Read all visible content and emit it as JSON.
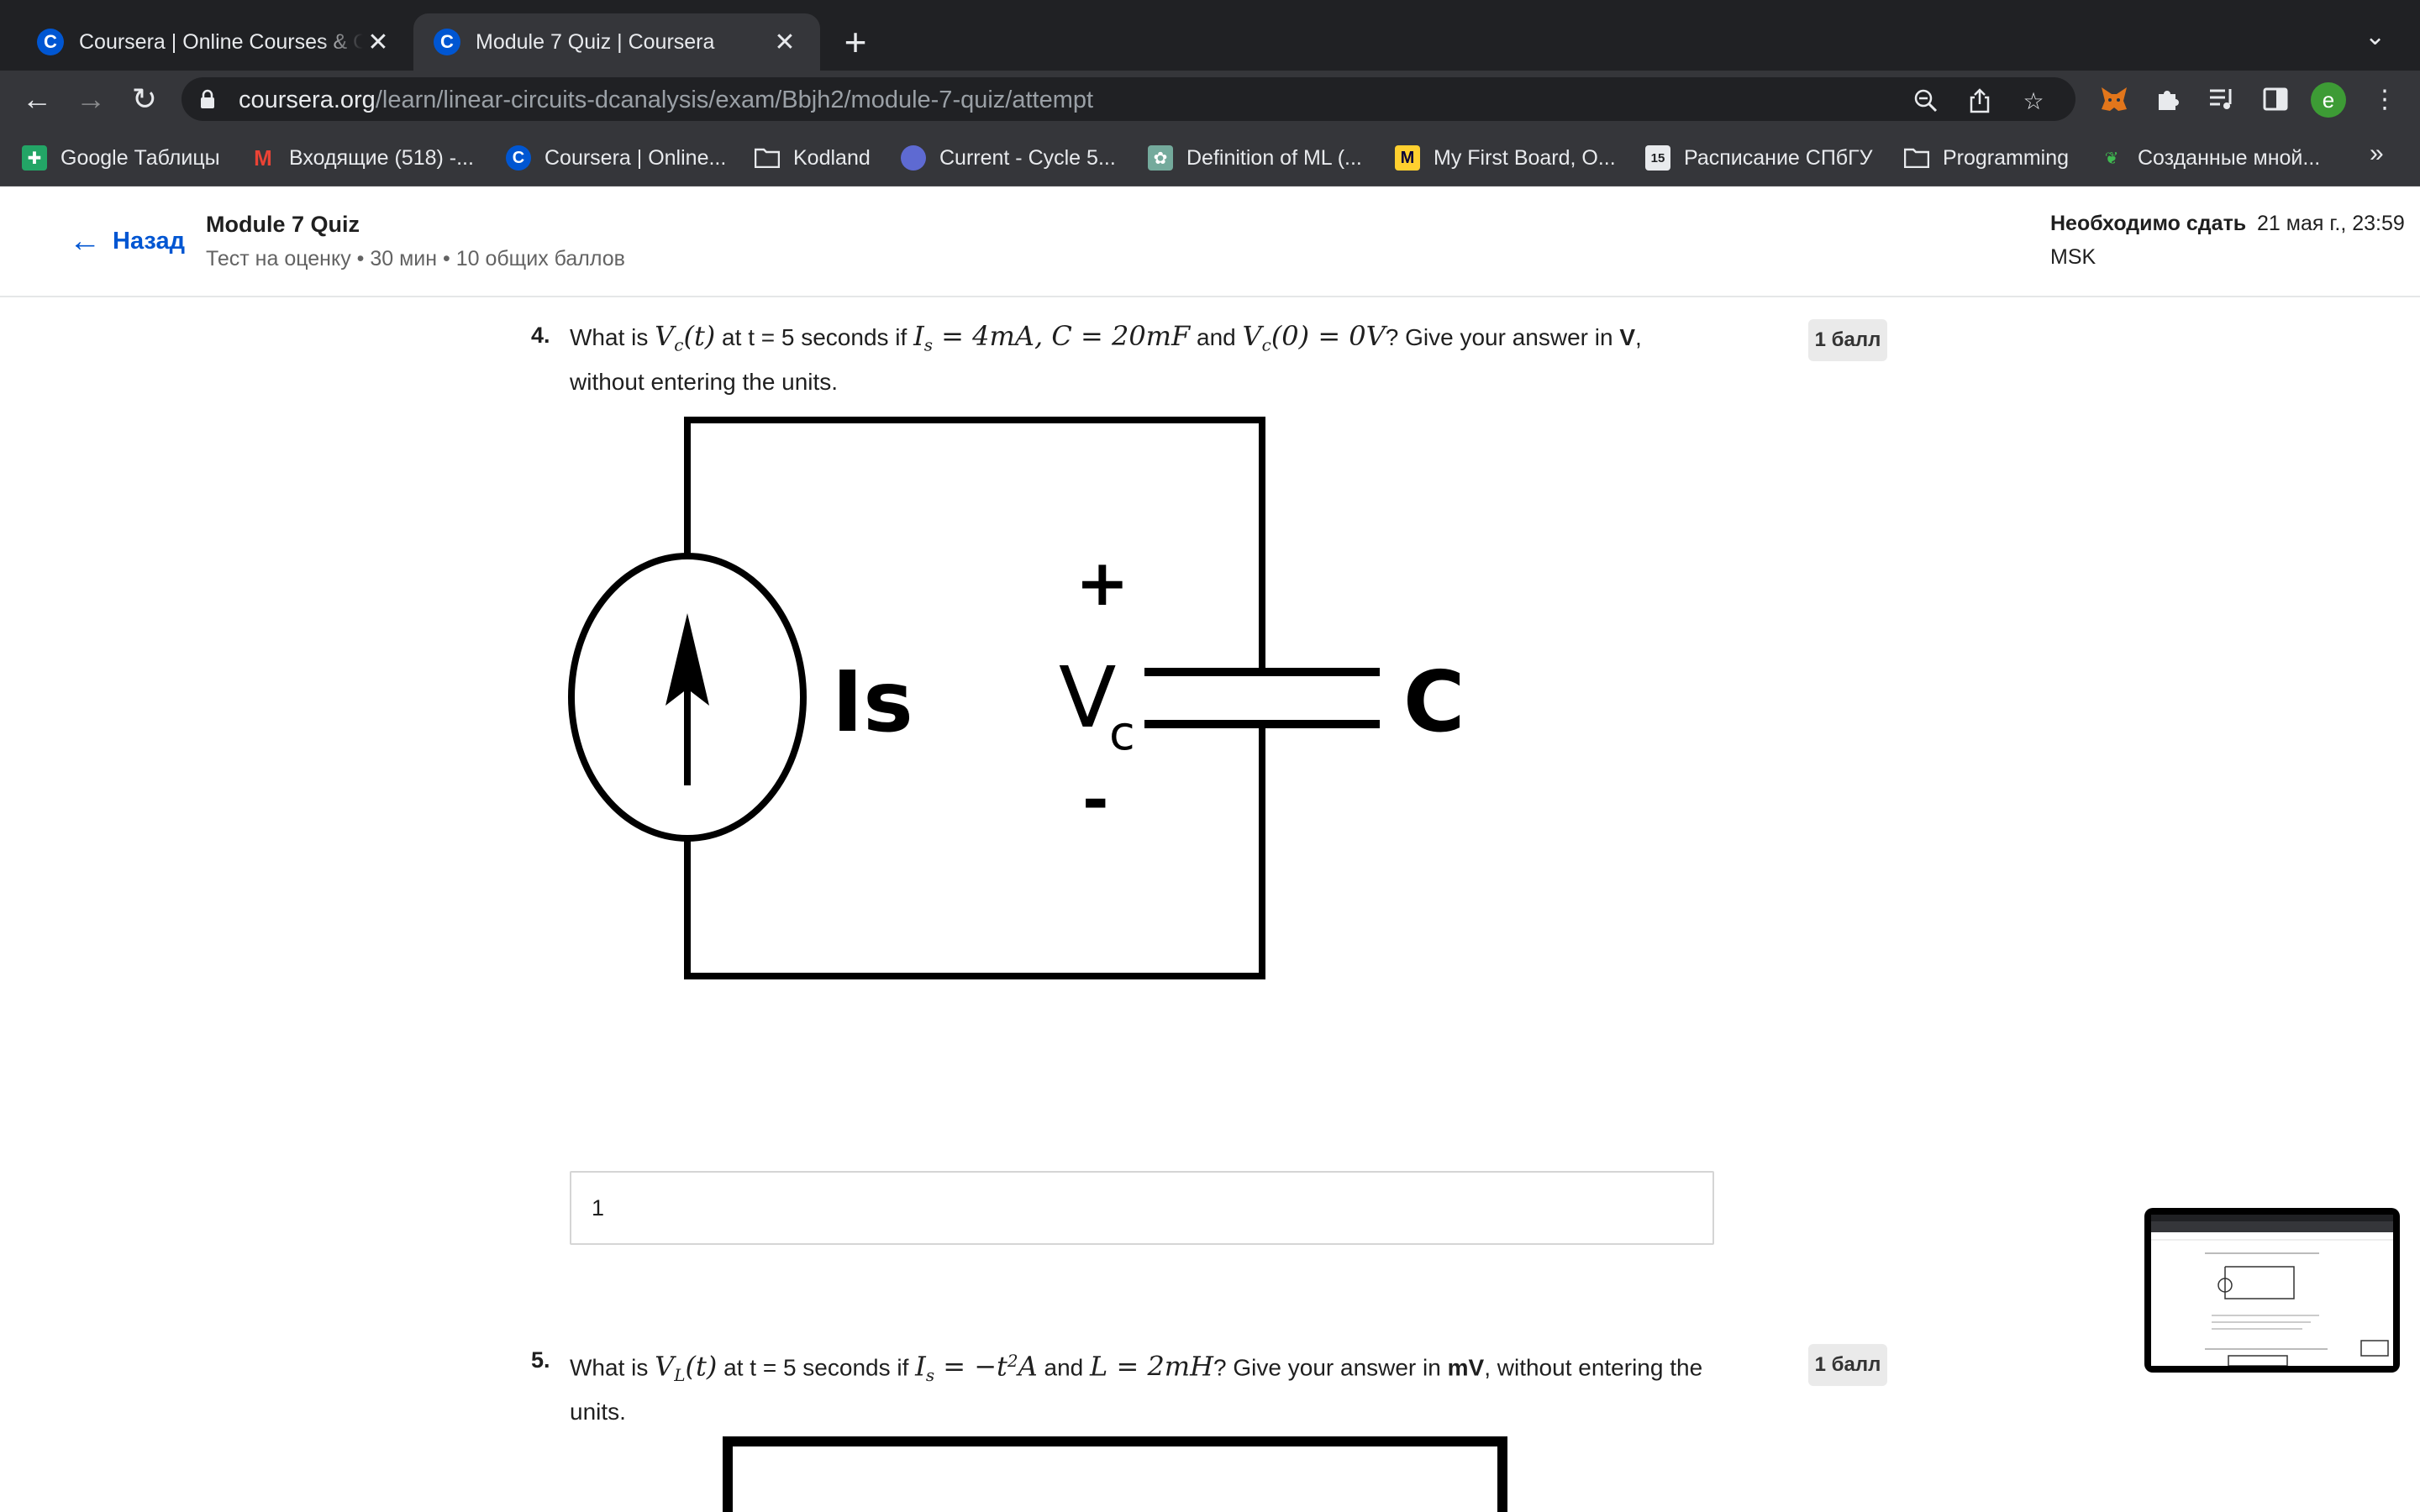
{
  "browser": {
    "tabs": [
      {
        "title": "Coursera | Online Courses & Credentials From Top Educators",
        "favicon": "C",
        "active": false
      },
      {
        "title": "Module 7 Quiz | Coursera",
        "favicon": "C",
        "active": true
      }
    ],
    "url_host": "coursera.org",
    "url_path": "/learn/linear-circuits-dcanalysis/exam/Bbjh2/module-7-quiz/attempt",
    "profile_initial": "e",
    "bookmarks": [
      {
        "label": "Google Таблицы",
        "icon": "sheets-icon"
      },
      {
        "label": "Входящие (518) -...",
        "icon": "gmail-icon"
      },
      {
        "label": "Coursera | Online...",
        "icon": "coursera-icon"
      },
      {
        "label": "Kodland",
        "icon": "folder-icon"
      },
      {
        "label": "Current - Cycle 5...",
        "icon": "linear-icon"
      },
      {
        "label": "Definition of ML (...",
        "icon": "chatgpt-icon"
      },
      {
        "label": "My First Board, O...",
        "icon": "miro-icon"
      },
      {
        "label": "Расписание СПбГУ",
        "icon": "calendar-icon"
      },
      {
        "label": "Programming",
        "icon": "folder-icon"
      },
      {
        "label": "Созданные мной...",
        "icon": "leaf-icon"
      }
    ],
    "bookmarks_more": "»"
  },
  "header": {
    "back_label": "Назад",
    "quiz_title": "Module 7 Quiz",
    "quiz_meta": "Тест на оценку • 30 мин • 10 общих баллов",
    "due_label": "Необходимо сдать",
    "due_date": "21 мая г., 23:59",
    "due_tz": "MSK"
  },
  "questions": [
    {
      "number": "4.",
      "parts": {
        "p1": "What is ",
        "m1": "V",
        "m1sub": "c",
        "m1b": "(t)",
        "p2": " at t = 5 seconds if ",
        "m2": "I",
        "m2sub": "s",
        "m2b": " = 4mA, C = 20mF",
        "p3": " and ",
        "m3": "V",
        "m3sub": "c",
        "m3b": "(0) = 0V",
        "p4": "? Give your answer in ",
        "unit": "V",
        "p5": ", without entering the units."
      },
      "points": "1 балл",
      "answer": "1",
      "circuit_labels": {
        "source": "Is",
        "plus": "+",
        "minus": "-",
        "voltage": "V",
        "voltage_sub": "c",
        "cap": "C"
      }
    },
    {
      "number": "5.",
      "parts": {
        "p1": "What is ",
        "m1": "V",
        "m1sub": "L",
        "m1b": "(t)",
        "p2": " at t = 5 seconds if ",
        "m2": "I",
        "m2sub": "s",
        "m2b": " = −t",
        "m2sup": "2",
        "m2c": "A",
        "p3": " and ",
        "m3": "L = 2mH",
        "p4": "? Give your answer in ",
        "unit": "mV",
        "p5": ", without entering the units."
      },
      "points": "1 балл"
    }
  ]
}
